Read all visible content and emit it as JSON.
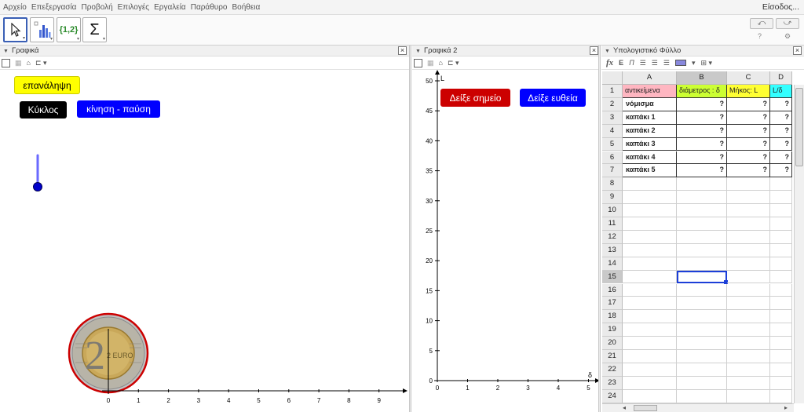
{
  "menu": [
    "Αρχείο",
    "Επεξεργασία",
    "Προβολή",
    "Επιλογές",
    "Εργαλεία",
    "Παράθυρο",
    "Βοήθεια"
  ],
  "signin": "Είσοδος...",
  "toolbar": {
    "tools": [
      {
        "name": "move-tool",
        "icon": "cursor-arrow-icon"
      },
      {
        "name": "chart-tool",
        "icon": "bar-chart-icon"
      },
      {
        "name": "list-tool",
        "icon": "list-braces-icon",
        "label": "{1,2}"
      },
      {
        "name": "sum-tool",
        "icon": "sigma-icon",
        "label": "Σ"
      }
    ],
    "undo": "⤺",
    "redo": "⤻",
    "help": "?",
    "settings": "⚙"
  },
  "graphics1": {
    "title": "Γραφικά",
    "buttons": [
      {
        "label": "επανάληψη",
        "bg": "#ffff00",
        "color": "#000000"
      },
      {
        "label": "Κύκλος",
        "bg": "#000000",
        "color": "#ffffff"
      },
      {
        "label": "κίνηση - παύση",
        "bg": "#0000ff",
        "color": "#ffffff"
      }
    ],
    "x_ticks": [
      "0",
      "1",
      "2",
      "3",
      "4",
      "5",
      "6",
      "7",
      "8",
      "9"
    ],
    "coin_text": "2 EURO",
    "coin_digit": "2",
    "slider_color": "#0000cc"
  },
  "graphics2": {
    "title": "Γραφικά 2",
    "buttons": [
      {
        "label": "Δείξε σημείο",
        "bg": "#cc0000",
        "color": "#ffffff"
      },
      {
        "label": "Δείξε ευθεία",
        "bg": "#0000ff",
        "color": "#ffffff"
      }
    ],
    "y_axis_label": "L",
    "x_axis_label": "δ",
    "y_ticks": [
      "0",
      "5",
      "10",
      "15",
      "20",
      "25",
      "30",
      "35",
      "40",
      "45",
      "50"
    ],
    "x_ticks": [
      "0",
      "1",
      "2",
      "3",
      "4",
      "5"
    ]
  },
  "spreadsheet": {
    "title": "Υπολογιστικό Φύλλο",
    "stylebar": [
      "fx",
      "E",
      "Π"
    ],
    "columns": [
      "A",
      "B",
      "C",
      "D"
    ],
    "header_row": [
      {
        "text": "αντικείμενα",
        "bg": "#ffb6c1"
      },
      {
        "text": "διάμετρος : δ",
        "bg": "#ccff33"
      },
      {
        "text": "Μήκος: L",
        "bg": "#ffff33"
      },
      {
        "text": "L/δ",
        "bg": "#33ffff"
      }
    ],
    "rows": [
      [
        "νόμισμα",
        "?",
        "?",
        "?"
      ],
      [
        "καπάκι 1",
        "?",
        "?",
        "?"
      ],
      [
        "καπάκι 2",
        "?",
        "?",
        "?"
      ],
      [
        "καπάκι 3",
        "?",
        "?",
        "?"
      ],
      [
        "καπάκι 4",
        "?",
        "?",
        "?"
      ],
      [
        "καπάκι 5",
        "?",
        "?",
        "?"
      ]
    ],
    "row_numbers": [
      "1",
      "2",
      "3",
      "4",
      "5",
      "6",
      "7",
      "8",
      "9",
      "10",
      "11",
      "12",
      "13",
      "14",
      "15",
      "16",
      "17",
      "18",
      "19",
      "20",
      "21",
      "22",
      "23",
      "24"
    ],
    "selected_row": "15",
    "selected_column": "B"
  }
}
